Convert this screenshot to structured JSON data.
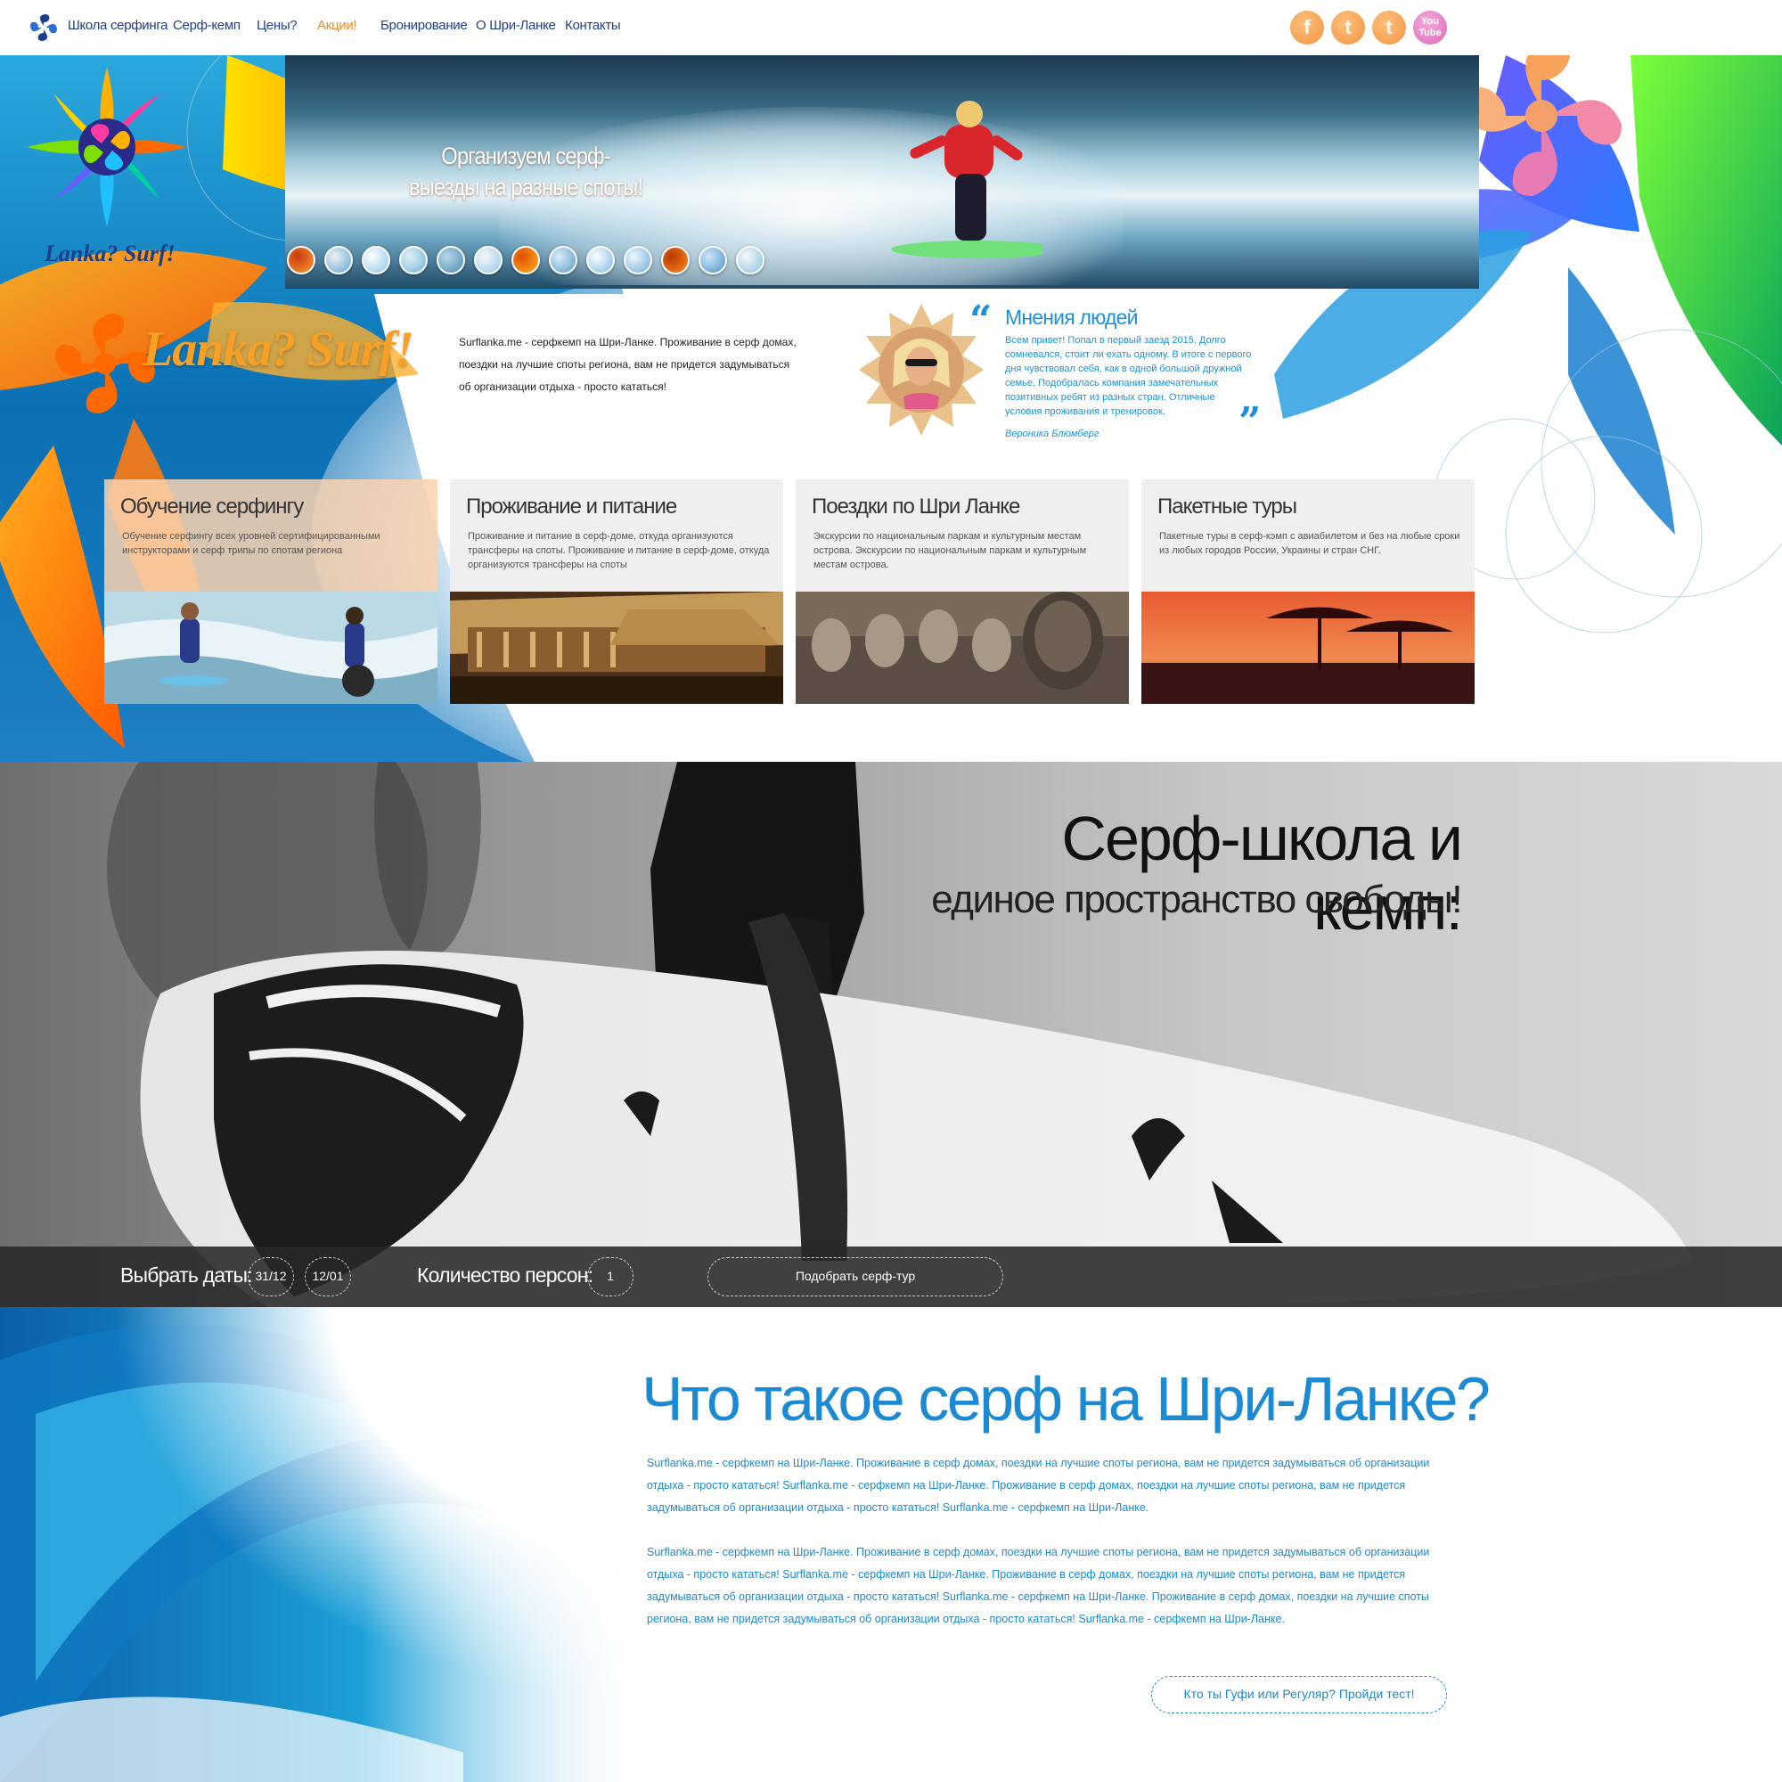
{
  "nav": {
    "items": [
      "Школа серфинга",
      "Серф-кемп",
      "Цены?",
      "Акции!",
      "Бронирование",
      "О Шри-Ланке",
      "Контакты"
    ],
    "active_index": 3,
    "social": [
      {
        "icon": "facebook-icon",
        "glyph": "f"
      },
      {
        "icon": "twitter-icon",
        "glyph": "t"
      },
      {
        "icon": "tumblr-icon",
        "glyph": "t"
      },
      {
        "icon": "youtube-icon",
        "glyph": "You Tube"
      }
    ]
  },
  "hero": {
    "slogan": "Организуем серф-выезды на разные споты!",
    "brand": "Lanka? Surf!",
    "slider_count": 13
  },
  "intro": {
    "text": "Surflanka.me - серфкемп на Шри-Ланке. Проживание в серф домах, поездки на лучшие споты региона, вам не придется задумываться об организации отдыха - просто кататься!"
  },
  "review": {
    "title": "Мнения людей",
    "text": "Всем привет! Попал в первый заезд 2015. Долго сомневался, стоит ли ехать одному. В итоге с первого дня чувствовал себя, как в одной большой дружной семье. Подобралась компания замечательных позитивных ребят из разных стран. Отличные условия проживания и тренировок.",
    "author": "Вероника Блюмберг"
  },
  "cards": [
    {
      "title": "Обучение серфингу",
      "text": "Обучение серфингу всех уровней сертифицированными инструкторами и серф трипы по спотам региона"
    },
    {
      "title": "Проживание и питание",
      "text": "Проживание и питание в серф-доме, откуда организуются трансферы на споты. Проживание и питание в серф-доме, откуда организуются трансферы на споты"
    },
    {
      "title": "Поездки по Шри Ланке",
      "text": "Экскурсии по национальным паркам и культурным местам острова. Экскурсии по национальным паркам и культурным местам острова."
    },
    {
      "title": "Пакетные туры",
      "text": "Пакетные туры в серф-кэмп с авиабилетом и без на любые сроки из любых городов России, Украины и стран СНГ."
    }
  ],
  "banner": {
    "title": "Серф-школа и кемп:",
    "subtitle": "единое пространство свободы!"
  },
  "booking": {
    "dates_label": "Выбрать даты:",
    "date_from": "31/12",
    "date_to": "12/01",
    "persons_label": "Количество персон:",
    "persons": "1",
    "submit": "Подобрать серф-тур"
  },
  "about": {
    "title": "Что такое серф на Шри-Ланке?",
    "p1": "Surflanka.me - серфкемп на Шри-Ланке. Проживание в серф домах, поездки на лучшие споты региона, вам не придется задумываться об организации отдыха - просто кататься! Surflanka.me - серфкемп на Шри-Ланке. Проживание в серф домах, поездки на лучшие споты региона, вам не придется задумываться об организации отдыха - просто кататься! Surflanka.me - серфкемп на Шри-Ланке.",
    "p2": "Surflanka.me - серфкемп на Шри-Ланке. Проживание в серф домах, поездки на лучшие споты региона, вам не придется задумываться об организации отдыха - просто кататься! Surflanka.me - серфкемп на Шри-Ланке. Проживание в серф домах, поездки на лучшие споты региона, вам не придется задумываться об организации отдыха - просто кататься! Surflanka.me - серфкемп на Шри-Ланке. Проживание в серф домах, поездки на лучшие споты региона, вам не придется задумываться об организации отдыха - просто кататься! Surflanka.me - серфкемп на Шри-Ланке.",
    "test_button": "Кто ты Гуфи или Регуляр? Пройди тест!"
  },
  "colors": {
    "accent_blue": "#1b8ad2",
    "nav_blue": "#1d3f8a",
    "accent_orange": "#f08a1e"
  }
}
